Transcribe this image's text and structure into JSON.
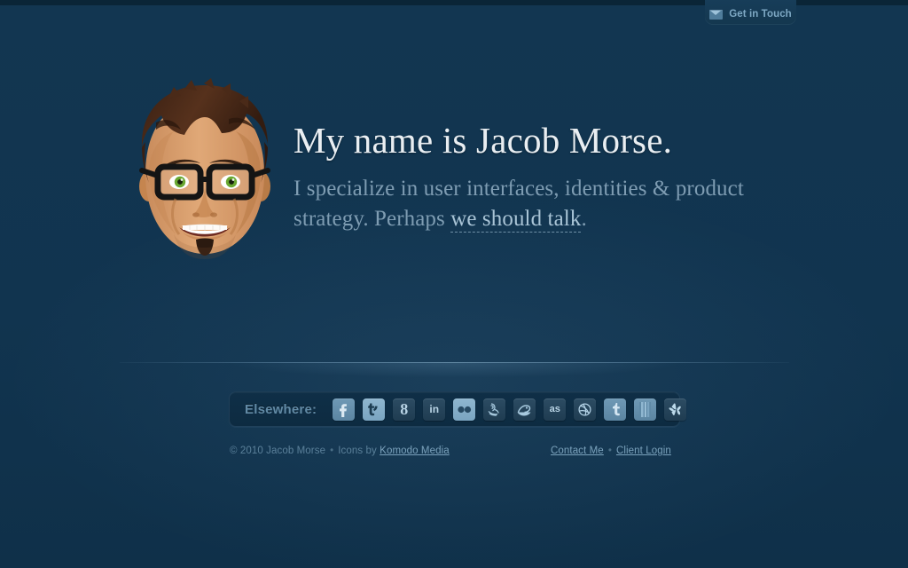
{
  "theme": {
    "background": "#11344f",
    "top_strip": "#0a2537",
    "heading_color": "#e9eef2",
    "tagline_color": "#7e9cb2",
    "link_color": "#a9c4d6",
    "footer_color": "#5b809a",
    "bar_background": "#0e2d45"
  },
  "header": {
    "tab": {
      "label": "Get in Touch",
      "icon": "envelope-icon"
    }
  },
  "hero": {
    "avatar_alt": "Illustrated portrait of Jacob Morse",
    "headline": "My name is Jacob Morse.",
    "tagline": {
      "part1": "I specialize in user interfaces, identities & product strategy. Perhaps ",
      "link": "we should talk",
      "part2": "."
    }
  },
  "elsewhere": {
    "label": "Elsewhere:",
    "links": [
      {
        "name": "facebook",
        "glyph": "f",
        "style": "mid"
      },
      {
        "name": "twitter",
        "glyph": "t",
        "style": "bright"
      },
      {
        "name": "google",
        "glyph": "8",
        "style": "dark"
      },
      {
        "name": "linkedin",
        "glyph": "in",
        "style": "dark"
      },
      {
        "name": "flickr",
        "glyph": "••",
        "style": "bright"
      },
      {
        "name": "beanstalk",
        "glyph": "",
        "style": "dark"
      },
      {
        "name": "basecamp",
        "glyph": "",
        "style": "dark"
      },
      {
        "name": "lastfm",
        "glyph": "as",
        "style": "dark"
      },
      {
        "name": "dribbble",
        "glyph": "",
        "style": "dark"
      },
      {
        "name": "tumblr",
        "glyph": "t",
        "style": "mid"
      },
      {
        "name": "gowalla",
        "glyph": "",
        "style": "mid"
      },
      {
        "name": "yelp",
        "glyph": "",
        "style": "dark"
      }
    ]
  },
  "footer": {
    "copyright": "© 2010 Jacob Morse",
    "separator": "•",
    "icons_credit_prefix": "Icons by ",
    "icons_credit_link": "Komodo Media",
    "contact_link": "Contact Me",
    "client_login_link": "Client Login"
  }
}
